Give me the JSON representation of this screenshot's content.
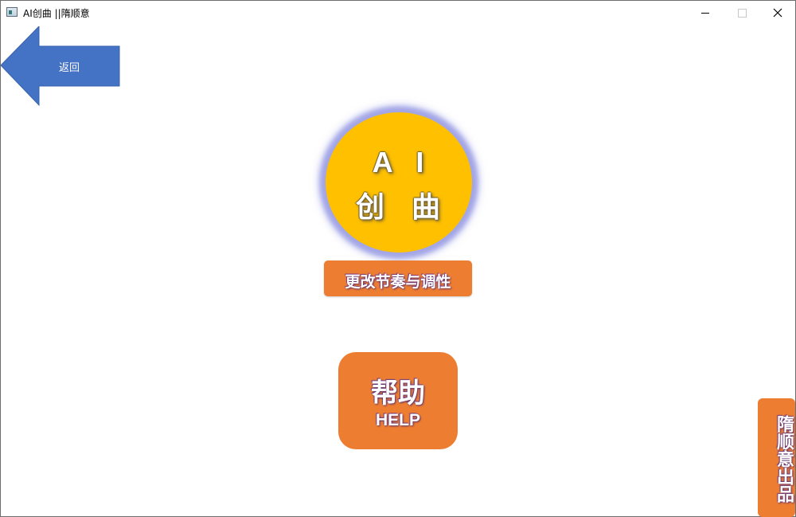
{
  "window": {
    "title": "AI创曲 ||隋顺意"
  },
  "back": {
    "label": "返回",
    "color": "#4472c4"
  },
  "ai_button": {
    "line1": "A I",
    "line2": "创 曲",
    "color": "#ffc000"
  },
  "tempo_button": {
    "label": "更改节奏与调性",
    "color": "#ed7d31"
  },
  "help_button": {
    "label_cn": "帮助",
    "label_en": "HELP",
    "color": "#ed7d31"
  },
  "credit": {
    "label": "隋顺意出品",
    "color": "#ed7d31"
  },
  "icons": [
    "app-icon",
    "minimize-icon",
    "maximize-icon",
    "close-icon",
    "back-arrow-icon"
  ]
}
